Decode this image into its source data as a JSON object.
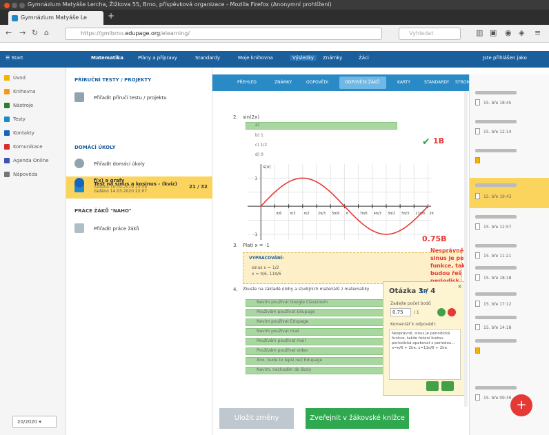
{
  "window": {
    "title": "Gymnázium Matyáše Lercha, Žižkova 55, Brno, příspěvková organizace - Mozilla Firefox (Anonymní prohlížení)"
  },
  "browser": {
    "tab_title": "Gymnázium Matyáše Le",
    "url_prefix": "https://gmlbrno.",
    "url_domain": "edupage.org",
    "url_rest": "/elearning/",
    "search_placeholder": "Vyhledat"
  },
  "appbar": {
    "start": "Start",
    "subject": "Matematika",
    "menu": [
      "Plány a přípravy",
      "Standardy",
      "Moje knihovna",
      "Výsledky",
      "Známky",
      "Žáci"
    ],
    "user": "Jste přihlášen jako"
  },
  "leftnav": {
    "items": [
      "Úvod",
      "Knihovna",
      "Nástroje",
      "Testy",
      "Kontakty",
      "Komunikace",
      "Agenda Online",
      "Nápověda"
    ],
    "date_select": "20/2020"
  },
  "course": {
    "section1": "PŘÍRUČNÍ TESTY / PROJEKTY",
    "item1": "Přiřadit příručí testu / projektu",
    "item2": "Test na sinus a kosinus - (kvíz)",
    "item2_sub": "zadáno 14.03.2020 22:07",
    "item2_score": "21 / 32",
    "section2": "DOMÁCÍ ÚKOLY",
    "item3": "Přiřadit domácí úkoly",
    "item4": "f(x) a grafy",
    "item4_sub": "zadáno 16.09.2019 23:08",
    "section3": "PRÁCE ŽÁKŮ \"NAHO\"",
    "item5": "Přiřadit práce žáků"
  },
  "tabstrip": [
    "PŘEHLED",
    "ZNÁMKY",
    "ODPOVĚDI",
    "ODPOVĚDI ŽÁKŮ",
    "KARTY",
    "STANDARDY",
    "STROM STANDARDŮ"
  ],
  "question2": {
    "num": "2.",
    "text": "sin(2x)",
    "options": [
      "a)",
      "b) 1",
      "c) 1/2",
      "d) 0"
    ],
    "points": "1B"
  },
  "question3": {
    "num": "3.",
    "text": "Platí x = -1",
    "work_label": "VYPRACOVÁNÍ:",
    "work_lines": [
      "sinus x = 1/2",
      "x = π/6, 11π/6"
    ],
    "points": "0.75B",
    "remark_lines": [
      "Nesprávně,",
      "sinus je pe",
      "funkce, tak",
      "budou řeš",
      "periodick"
    ]
  },
  "question4": {
    "num": "4.",
    "text": "Zkuste na základě úlohy a studijních materiálů z matematiky",
    "options": [
      "Nevím používat Google Classroom",
      "Používám používat Edupage",
      "Nevím používat Edupage",
      "Nevím používat mail",
      "Používám používat mail",
      "Používám používat video",
      "Ano, bude to lepší než Edupage",
      "Nevím, nechodím do školy"
    ]
  },
  "popup": {
    "title": "Otázka 3 / 4",
    "points": "1P",
    "score_label": "Zadejte počet bodů",
    "score_value": "0.75",
    "of": "/ 1",
    "comment_label": "Komentář k odpovědi:",
    "comment": "Nesprávně, sinus je periodická funkce, takže řešení budou periodická opakovat s periodou... x=π/6 + 2kπ, x=11π/6 + 2kπ"
  },
  "rightpanel": {
    "dates": [
      "15. bře 18:45",
      "15. bře 12:14",
      "",
      "15. bře 19:43",
      "15. bře 12:57",
      "15. bře 11:21",
      "15. bře 18:18",
      "15. bře 17:12",
      "15. bře 14:18",
      "15. bře 09:39"
    ]
  },
  "footer": {
    "save": "Uložit změny",
    "publish": "Zveřejnit v žákovské knížce"
  },
  "chart_data": {
    "type": "line",
    "title": "",
    "xlabel": "",
    "ylabel": "s(x)",
    "x": [
      0,
      0.5236,
      1.0472,
      1.5708,
      2.0944,
      2.618,
      3.1416,
      3.6652,
      4.1888,
      4.7124,
      5.236,
      5.7596,
      6.2832
    ],
    "series": [
      {
        "values": [
          0,
          0.5,
          0.866,
          1,
          0.866,
          0.5,
          0,
          -0.5,
          -0.866,
          -1,
          -0.866,
          -0.5,
          0
        ]
      }
    ],
    "ylim": [
      -1.2,
      1.5
    ],
    "xlim": [
      -0.5,
      6.4
    ],
    "tick_labels": [
      "π/6",
      "π/3",
      "π/2",
      "2π/3",
      "5π/6",
      "π",
      "7π/6",
      "4π/3",
      "3π/2",
      "5π/3",
      "11π/6",
      "2π"
    ],
    "y_ticks": [
      "1",
      "-1"
    ],
    "grid": true
  }
}
